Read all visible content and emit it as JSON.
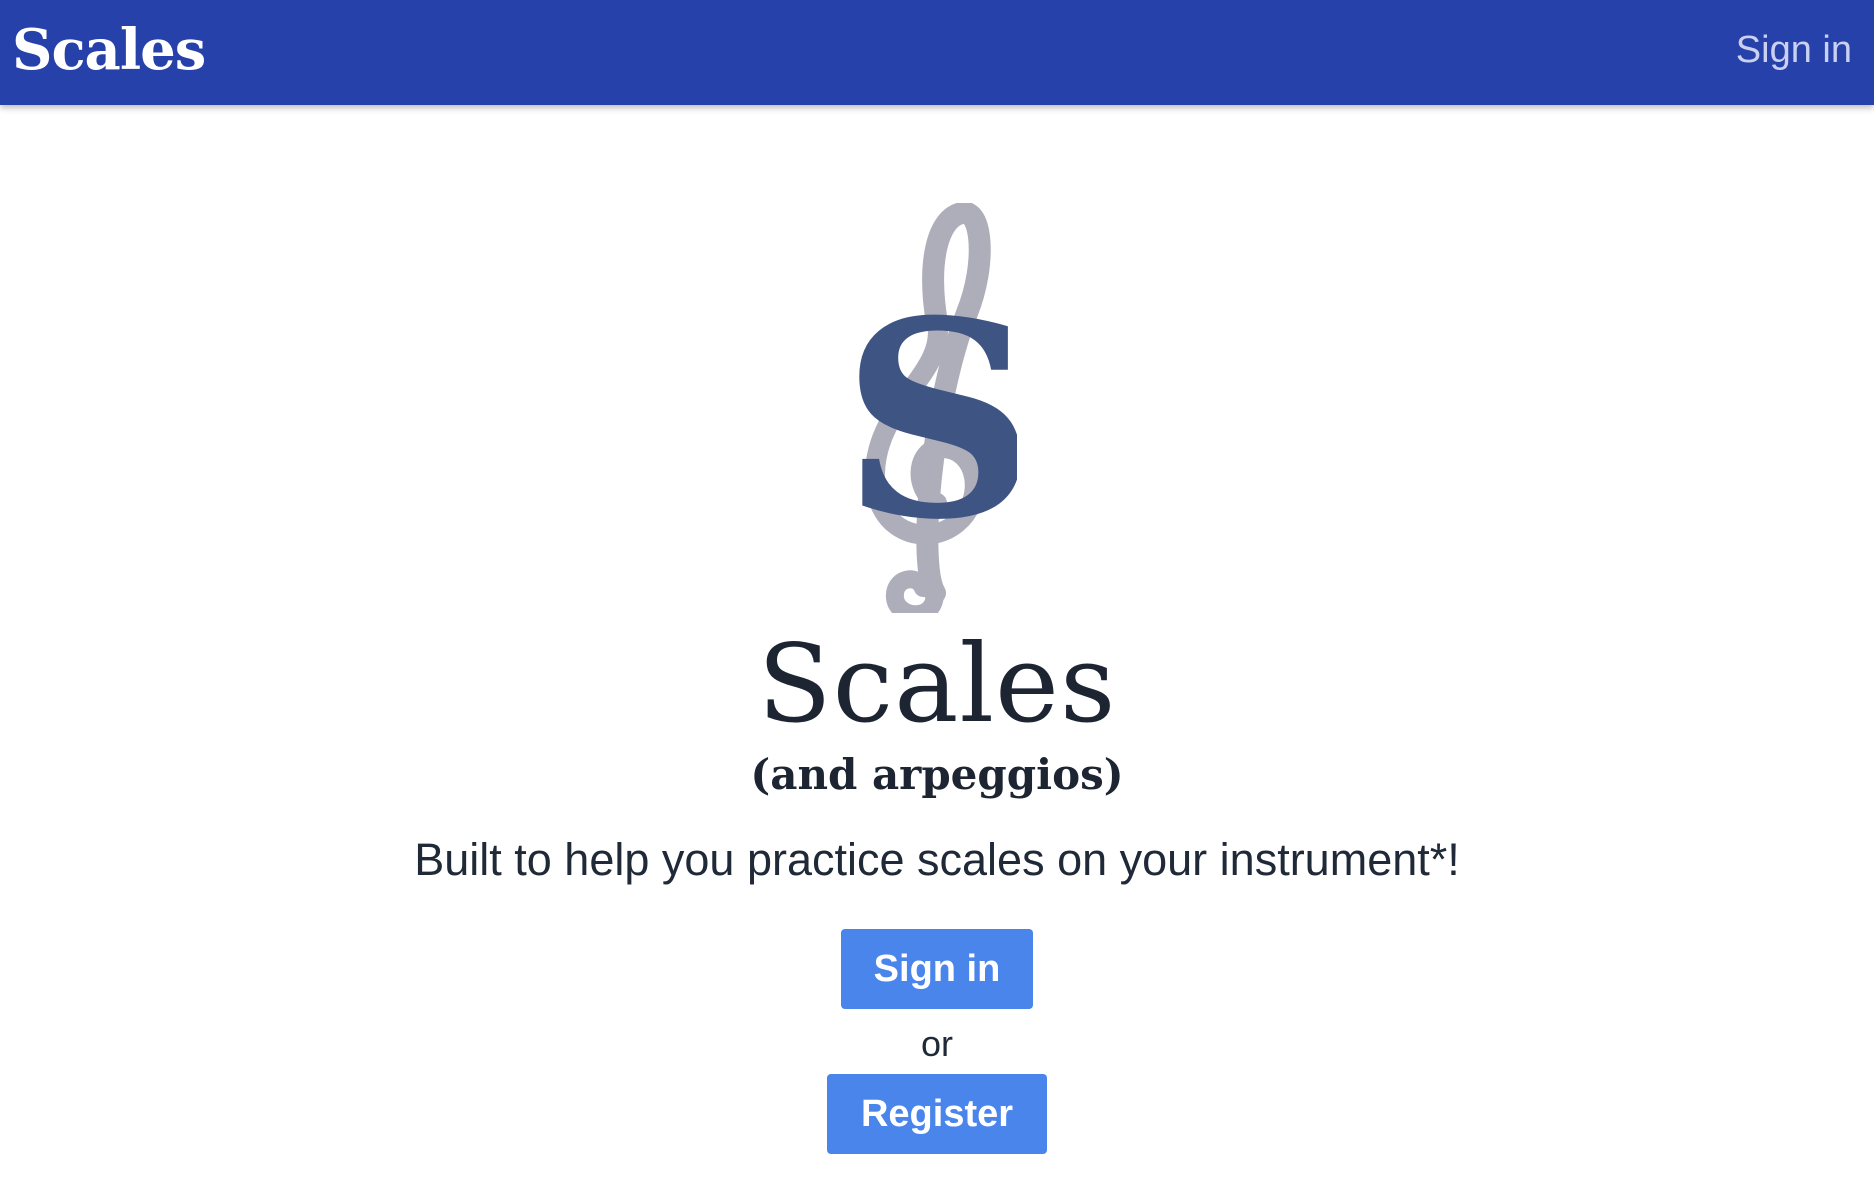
{
  "navbar": {
    "brand": "Scales",
    "sign_in_link": "Sign in",
    "background_color": "#2741aa"
  },
  "hero": {
    "logo_icon": "treble-clef-s-logo",
    "title": "Scales",
    "subtitle": "(and arpeggios)",
    "tagline": "Built to help you practice scales on your instrument*!"
  },
  "actions": {
    "sign_in_label": "Sign in",
    "or_text": "or",
    "register_label": "Register",
    "button_color": "#4a85ec"
  }
}
